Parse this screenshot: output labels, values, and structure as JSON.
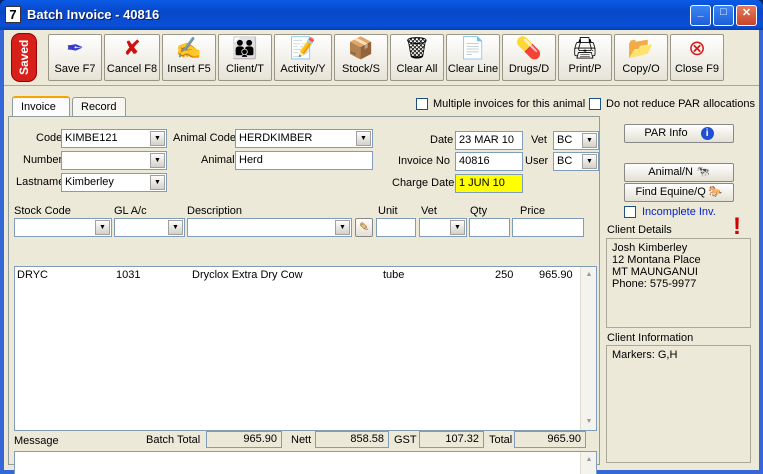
{
  "window": {
    "title": "Batch Invoice - 40816",
    "app_icon_text": "7",
    "minimize_glyph": "_",
    "maximize_glyph": "□",
    "close_glyph": "✕"
  },
  "toolbar": {
    "saved_badge": "Saved",
    "buttons": [
      {
        "label": "Save F7",
        "icon": "quill-pen-icon",
        "glyph": "✒"
      },
      {
        "label": "Cancel F8",
        "icon": "red-x-icon",
        "glyph": "✘"
      },
      {
        "label": "Insert F5",
        "icon": "hand-writing-icon",
        "glyph": "✍"
      },
      {
        "label": "Client/T",
        "icon": "people-icon",
        "glyph": "👪"
      },
      {
        "label": "Activity/Y",
        "icon": "activity-icon",
        "glyph": "📝"
      },
      {
        "label": "Stock/S",
        "icon": "stock-box-icon",
        "glyph": "📦"
      },
      {
        "label": "Clear All",
        "icon": "trash-bin-icon",
        "glyph": "🗑"
      },
      {
        "label": "Clear Line",
        "icon": "clear-line-icon",
        "glyph": "📄"
      },
      {
        "label": "Drugs/D",
        "icon": "pill-icon",
        "glyph": "💊"
      },
      {
        "label": "Print/P",
        "icon": "printer-icon",
        "glyph": "🖨"
      },
      {
        "label": "Copy/O",
        "icon": "folder-copy-icon",
        "glyph": "📂"
      },
      {
        "label": "Close F9",
        "icon": "close-circle-icon",
        "glyph": "⊗"
      }
    ]
  },
  "tabs": [
    "Invoice",
    "Record"
  ],
  "options": {
    "multiple_invoices": "Multiple invoices for this animal",
    "no_reduce_par": "Do not reduce PAR allocations"
  },
  "form": {
    "code_label": "Code",
    "code_value": "KIMBE121",
    "number_label": "Number",
    "number_value": "",
    "lastname_label": "Lastname",
    "lastname_value": "Kimberley",
    "animal_code_label": "Animal Code",
    "animal_code_value": "HERDKIMBER",
    "animal_label": "Animal",
    "animal_value": "Herd",
    "date_label": "Date",
    "date_value": "23 MAR 10",
    "invoice_no_label": "Invoice No",
    "invoice_no_value": "40816",
    "charge_date_label": "Charge Date",
    "charge_date_value": "1 JUN 10",
    "vet_label": "Vet",
    "vet_value": "BC",
    "user_label": "User",
    "user_value": "BC"
  },
  "line_headers": {
    "stock_code": "Stock Code",
    "gl": "GL A/c",
    "description": "Description",
    "unit": "Unit",
    "vet": "Vet",
    "qty": "Qty",
    "price": "Price"
  },
  "lines": [
    {
      "stock_code": "DRYC",
      "gl": "1031",
      "description": "Dryclox Extra Dry Cow",
      "unit": "tube",
      "qty": "250",
      "price": "965.90"
    }
  ],
  "scroll": {
    "up": "▲",
    "down": "▼"
  },
  "totals": {
    "message_label": "Message",
    "batch_total_label": "Batch Total",
    "batch_total": "965.90",
    "nett_label": "Nett",
    "nett": "858.58",
    "gst_label": "GST",
    "gst": "107.32",
    "total_label": "Total",
    "total": "965.90"
  },
  "right": {
    "par_info": "PAR Info",
    "info_glyph": "i",
    "animal_button": "Animal/N",
    "find_equine_button": "Find Equine/Q",
    "incomplete_inv": "Incomplete Inv.",
    "alert_glyph": "!",
    "client_details_label": "Client Details",
    "client_details": [
      "Josh Kimberley",
      "12 Montana Place",
      "MT MAUNGANUI",
      "Phone: 575-9977"
    ],
    "client_info_label": "Client Information",
    "client_info": "Markers: G,H"
  }
}
